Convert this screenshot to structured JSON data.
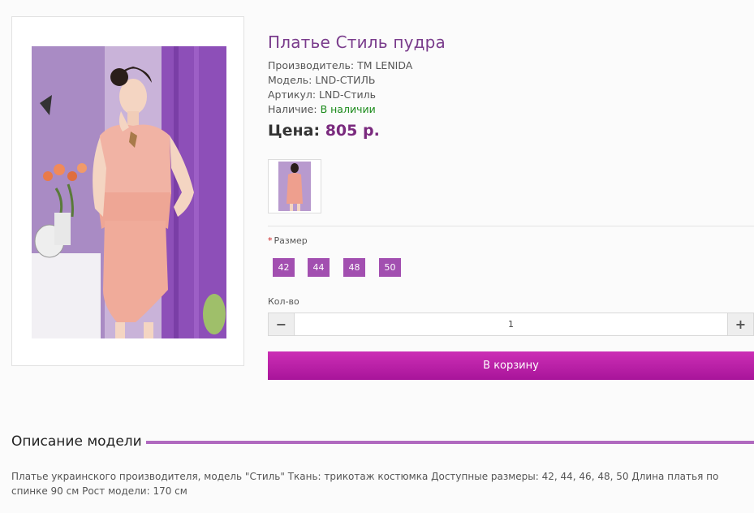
{
  "product": {
    "title": "Платье Стиль пудра",
    "manufacturer_label": "Производитель:",
    "manufacturer": "TM LENIDA",
    "model_label": "Модель:",
    "model": "LND-СТИЛЬ",
    "sku_label": "Артикул:",
    "sku": "LND-Стиль",
    "availability_label": "Наличие:",
    "availability": "В наличии",
    "price_label": "Цена:",
    "price": "805 р."
  },
  "options": {
    "size_label": "Размер",
    "required_mark": "*",
    "sizes": [
      "42",
      "44",
      "48",
      "50"
    ],
    "qty_label": "Кол-во",
    "qty_value": "1",
    "minus": "−",
    "plus": "+"
  },
  "cart": {
    "button_label": "В корзину"
  },
  "description": {
    "title": "Описание модели",
    "text": "Платье украинского производителя, модель \"Стиль\" Ткань: трикотаж костюмка Доступные размеры: 42, 44, 46, 48, 50 Длина платья по спинке 90 см Рост модели: 170 см"
  },
  "colors": {
    "accent": "#a24fb0",
    "title": "#7a3c8c",
    "availability": "#1a8a1a",
    "cart_button": "#b51ca5"
  }
}
